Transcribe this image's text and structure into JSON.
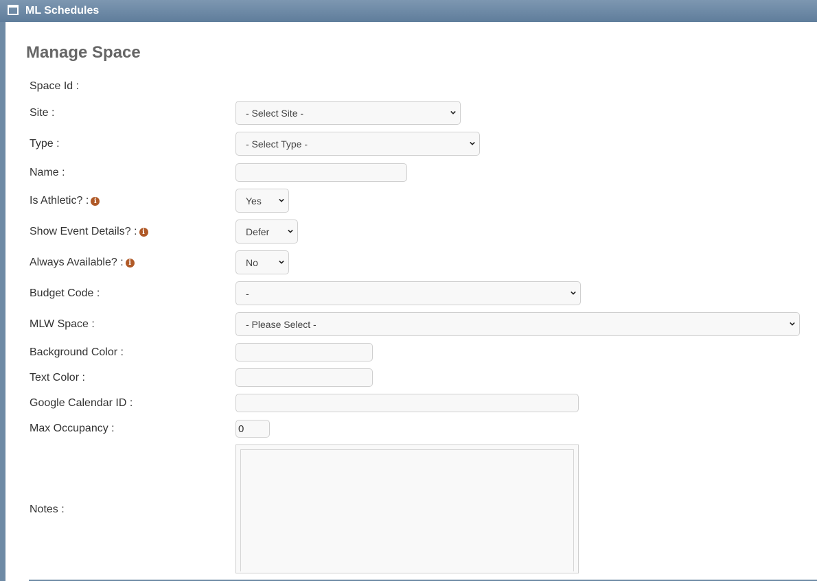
{
  "window": {
    "title": "ML Schedules",
    "icon": "window-icon"
  },
  "page": {
    "title": "Manage Space"
  },
  "form": {
    "space_id_label": "Space Id :",
    "site": {
      "label": "Site :",
      "value": "- Select Site -"
    },
    "type": {
      "label": "Type :",
      "value": "- Select Type -"
    },
    "name": {
      "label": "Name :",
      "value": ""
    },
    "is_athletic": {
      "label": "Is Athletic? :",
      "value": "Yes"
    },
    "show_event_details": {
      "label": "Show Event Details? :",
      "value": "Defer"
    },
    "always_available": {
      "label": "Always Available? :",
      "value": "No"
    },
    "budget_code": {
      "label": "Budget Code :",
      "value": "-"
    },
    "mlw_space": {
      "label": "MLW Space :",
      "value": "- Please Select -"
    },
    "background_color": {
      "label": "Background Color :",
      "value": ""
    },
    "text_color": {
      "label": "Text Color :",
      "value": ""
    },
    "google_calendar_id": {
      "label": "Google Calendar ID :",
      "value": ""
    },
    "max_occupancy": {
      "label": "Max Occupancy :",
      "value": "0"
    },
    "notes": {
      "label": "Notes :",
      "value": ""
    },
    "info_icon_glyph": "i"
  },
  "colors": {
    "titlebar": "#6e8aa5",
    "info_icon": "#b05a28",
    "page_title": "#666666"
  }
}
